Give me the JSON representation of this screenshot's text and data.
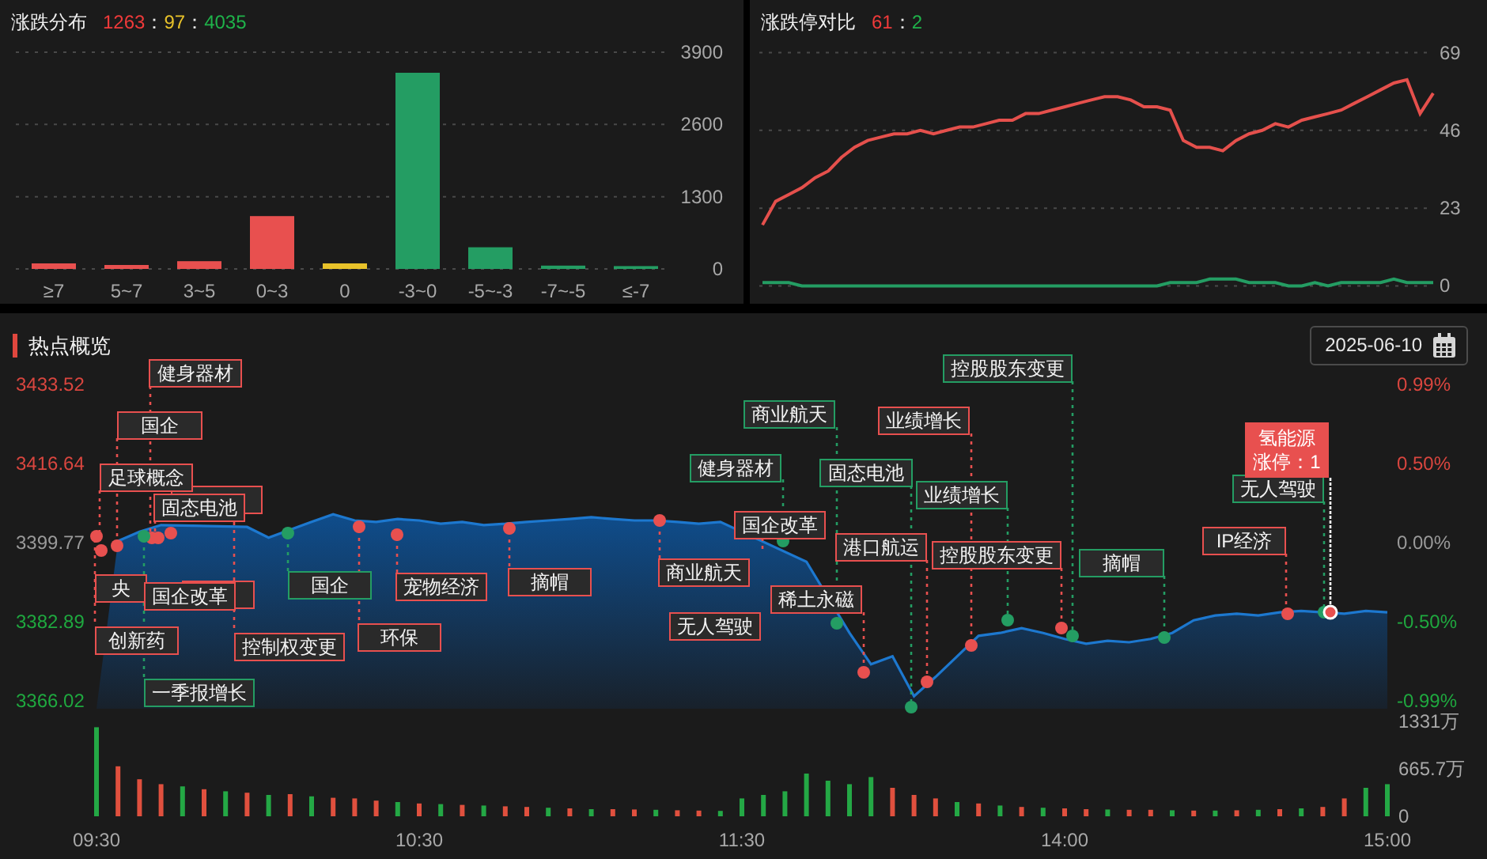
{
  "distribution": {
    "title": "涨跌分布",
    "counts": [
      {
        "text": "1263",
        "color": "#f03a3a"
      },
      {
        "text": "："
      },
      {
        "text": "97",
        "color": "#e8c22a"
      },
      {
        "text": "："
      },
      {
        "text": "4035",
        "color": "#1fb34a"
      }
    ],
    "chart_data": {
      "type": "bar",
      "categories": [
        "≥7",
        "5~7",
        "3~5",
        "0~3",
        "0",
        "-3~0",
        "-5~-3",
        "-7~-5",
        "≤-7"
      ],
      "ylim": [
        0,
        3900
      ],
      "yticks": [
        0,
        1300,
        2600,
        3900
      ],
      "stacked": true,
      "series": [
        {
          "color": "#e8504f",
          "values": [
            100,
            70,
            140,
            950,
            null,
            null,
            null,
            null,
            null
          ]
        },
        {
          "color": "#e8c22a",
          "values": [
            null,
            null,
            null,
            null,
            100,
            null,
            null,
            null,
            null
          ]
        },
        {
          "color": "#249d63",
          "values": [
            null,
            null,
            null,
            null,
            null,
            3530,
            390,
            60,
            50
          ]
        }
      ]
    }
  },
  "limit_compare": {
    "title": "涨跌停对比",
    "counts": [
      {
        "text": "61",
        "color": "#f03a3a"
      },
      {
        "text": "："
      },
      {
        "text": "2",
        "color": "#1fb34a"
      }
    ],
    "chart_data": {
      "type": "line",
      "ylim": [
        0,
        69
      ],
      "yticks": [
        0,
        23,
        46,
        69
      ],
      "series": [
        {
          "color": "#e5504c",
          "values": [
            18,
            25,
            27,
            29,
            32,
            34,
            38,
            41,
            43,
            44,
            45,
            45,
            46,
            45,
            46,
            47,
            47,
            48,
            49,
            49,
            51,
            51,
            52,
            53,
            54,
            55,
            56,
            56,
            55,
            53,
            53,
            52,
            43,
            41,
            41,
            40,
            43,
            45,
            46,
            48,
            47,
            49,
            50,
            51,
            52,
            54,
            56,
            58,
            60,
            61,
            51,
            57
          ]
        },
        {
          "color": "#249d63",
          "values": [
            1,
            1,
            1,
            0,
            0,
            0,
            0,
            0,
            0,
            0,
            0,
            0,
            0,
            0,
            0,
            0,
            0,
            0,
            0,
            0,
            0,
            0,
            0,
            0,
            0,
            0,
            0,
            0,
            0,
            0,
            0,
            1,
            1,
            1,
            2,
            2,
            2,
            1,
            1,
            1,
            0,
            0,
            1,
            0,
            1,
            1,
            1,
            1,
            2,
            1,
            1,
            1
          ]
        }
      ]
    }
  },
  "hotspots": {
    "title": "热点概览",
    "date": "2025-06-10",
    "price_chart": {
      "chart_data": {
        "type": "area",
        "ylim": [
          3366.02,
          3433.52
        ],
        "categories": [
          null,
          null,
          null,
          null,
          null,
          null,
          null,
          null,
          null,
          null,
          null,
          null,
          null,
          null,
          null,
          null,
          null,
          null,
          null,
          null,
          null,
          null,
          null,
          null,
          null,
          null,
          null,
          null,
          null,
          null,
          null,
          null,
          null,
          null,
          null,
          null,
          null,
          null,
          null,
          null,
          null,
          null,
          null,
          null,
          null,
          null,
          null,
          null,
          null,
          null,
          null,
          null,
          null,
          null,
          null,
          null,
          null,
          null,
          null,
          null,
          null
        ],
        "yticks": [
          {
            "value": 3433.52,
            "label": "3433.52"
          },
          {
            "value": 3416.64,
            "label": "3416.64"
          },
          {
            "value": 3399.77,
            "label": "3399.77"
          },
          {
            "value": 3382.89,
            "label": "3382.89"
          },
          {
            "value": 3366.02,
            "label": "3366.02"
          }
        ],
        "series": [
          {
            "color": "#1d78cf",
            "values": [
              null,
              3400.1,
              3402.1,
              3403.5,
              null,
              null,
              null,
              3403.1,
              3400.8,
              null,
              3404.2,
              3405.8,
              3404.5,
              3404.2,
              3404.8,
              3404.5,
              3403.8,
              3404.2,
              3403.5,
              3403.8,
              3404.2,
              3404.5,
              3404.8,
              3405.2,
              3404.8,
              3404.5,
              3404.5,
              3404.2,
              3403.8,
              3404.2,
              null,
              null,
              null,
              3395.7,
              null,
              3380.5,
              3373.8,
              3375.5,
              3367.0,
              3371.1,
              3375.5,
              3379.9,
              3380.5,
              3381.5,
              3380.5,
              3379.2,
              3378.2,
              3378.8,
              3378.5,
              3379.2,
              3380.5,
              3383.2,
              3384.2,
              3384.6,
              3384.2,
              3384.9,
              3385.2,
              null,
              3384.6,
              3385.2,
              3384.9
            ]
          }
        ]
      },
      "left_axis_colors": [
        {
          "color": "#d9463f"
        },
        {
          "color": "#d9463f"
        },
        {
          "color": "#9a9a9a"
        },
        {
          "color": "#1fa83f"
        },
        {
          "color": "#1fa83f"
        }
      ],
      "right_axis": [
        {
          "label": "0.99%",
          "color": "#d9463f"
        },
        {
          "label": "0.50%",
          "color": "#d9463f"
        },
        {
          "label": "0.00%",
          "color": "#9a9a9a"
        },
        {
          "label": "-0.50%",
          "color": "#1fa83f"
        },
        {
          "label": "-0.99%",
          "color": "#1fa83f"
        }
      ]
    },
    "tags": [
      {
        "text": "健身器材",
        "color": "#e8504f"
      },
      {
        "text": "控股股东变更",
        "color": "#249d63"
      },
      {
        "text": "国企",
        "color": "#e8504f"
      },
      {
        "text": "商业航天",
        "color": "#249d63"
      },
      {
        "text": "业绩增长",
        "color": "#e8504f"
      },
      {
        "text": "足球概念",
        "color": "#e8504f"
      },
      {
        "text": "健身器材",
        "color": "#249d63"
      },
      {
        "text": "固态电池",
        "color": "#249d63"
      },
      {
        "color": "#e8504f"
      },
      {
        "text": "业绩增长",
        "color": "#249d63"
      },
      {
        "text": "无人驾驶",
        "color": "#249d63"
      },
      {
        "text": "固态电池",
        "color": "#e8504f"
      },
      {
        "text": "国企改革",
        "color": "#e8504f"
      },
      {
        "text": "港口航运",
        "color": "#e8504f"
      },
      {
        "text": "控股股东变更",
        "color": "#e8504f"
      },
      {
        "text": "摘帽",
        "color": "#249d63"
      },
      {
        "text": "IP经济",
        "color": "#e8504f"
      },
      {
        "text": "商业航天",
        "color": "#e8504f"
      },
      {
        "text": "央",
        "color": "#e8504f"
      },
      {
        "text": "国企改革",
        "color": "#e8504f"
      },
      {
        "color": "#e8504f"
      },
      {
        "text": "国企",
        "color": "#249d63"
      },
      {
        "text": "宠物经济",
        "color": "#e8504f"
      },
      {
        "text": "摘帽",
        "color": "#e8504f"
      },
      {
        "text": "稀土永磁",
        "color": "#e8504f"
      },
      {
        "text": "无人驾驶",
        "color": "#e8504f"
      },
      {
        "text": "创新药",
        "color": "#e8504f"
      },
      {
        "text": "控制权变更",
        "color": "#e8504f"
      },
      {
        "text": "环保",
        "color": "#e8504f"
      },
      {
        "text": "一季报增长",
        "color": "#249d63"
      }
    ],
    "callout": {
      "title": "氢能源",
      "text": "涨停：1"
    },
    "volume_chart": {
      "chart_data": {
        "type": "bar",
        "stacked": true,
        "ylim": [
          0,
          1331
        ],
        "yticks": [
          {
            "value": 1331,
            "label": "1331万"
          },
          {
            "value": 665.7,
            "label": "665.7万"
          },
          {
            "value": 0,
            "label": "0"
          }
        ],
        "categories": [
          "09:30",
          null,
          null,
          null,
          null,
          null,
          null,
          null,
          null,
          null,
          null,
          null,
          null,
          null,
          null,
          "10:30",
          null,
          null,
          null,
          null,
          null,
          null,
          null,
          null,
          null,
          null,
          null,
          null,
          null,
          null,
          "11:30",
          null,
          null,
          null,
          null,
          null,
          null,
          null,
          null,
          null,
          null,
          null,
          null,
          null,
          null,
          "14:00",
          null,
          null,
          null,
          null,
          null,
          null,
          null,
          null,
          null,
          null,
          null,
          null,
          null,
          null,
          "15:00"
        ],
        "series": [
          {
            "color": "#e0503e",
            "values": [
              null,
              700,
              520,
              450,
              null,
              380,
              null,
              330,
              null,
              310,
              null,
              260,
              250,
              220,
              null,
              180,
              null,
              160,
              null,
              140,
              130,
              null,
              110,
              null,
              100,
              95,
              null,
              85,
              80,
              null,
              null,
              null,
              null,
              null,
              null,
              null,
              null,
              400,
              300,
              250,
              null,
              180,
              null,
              130,
              null,
              110,
              100,
              null,
              90,
              90,
              null,
              80,
              null,
              85,
              null,
              100,
              null,
              130,
              250,
              null,
              null
            ]
          },
          {
            "color": "#24a845",
            "values": [
              1250,
              null,
              null,
              null,
              420,
              null,
              350,
              null,
              300,
              null,
              280,
              null,
              null,
              null,
              200,
              null,
              170,
              null,
              150,
              null,
              null,
              120,
              null,
              100,
              null,
              null,
              90,
              null,
              null,
              75,
              250,
              300,
              350,
              600,
              500,
              450,
              550,
              null,
              null,
              null,
              200,
              null,
              150,
              null,
              120,
              null,
              null,
              95,
              null,
              null,
              85,
              null,
              80,
              null,
              90,
              null,
              110,
              null,
              null,
              400,
              450
            ]
          }
        ]
      }
    }
  }
}
